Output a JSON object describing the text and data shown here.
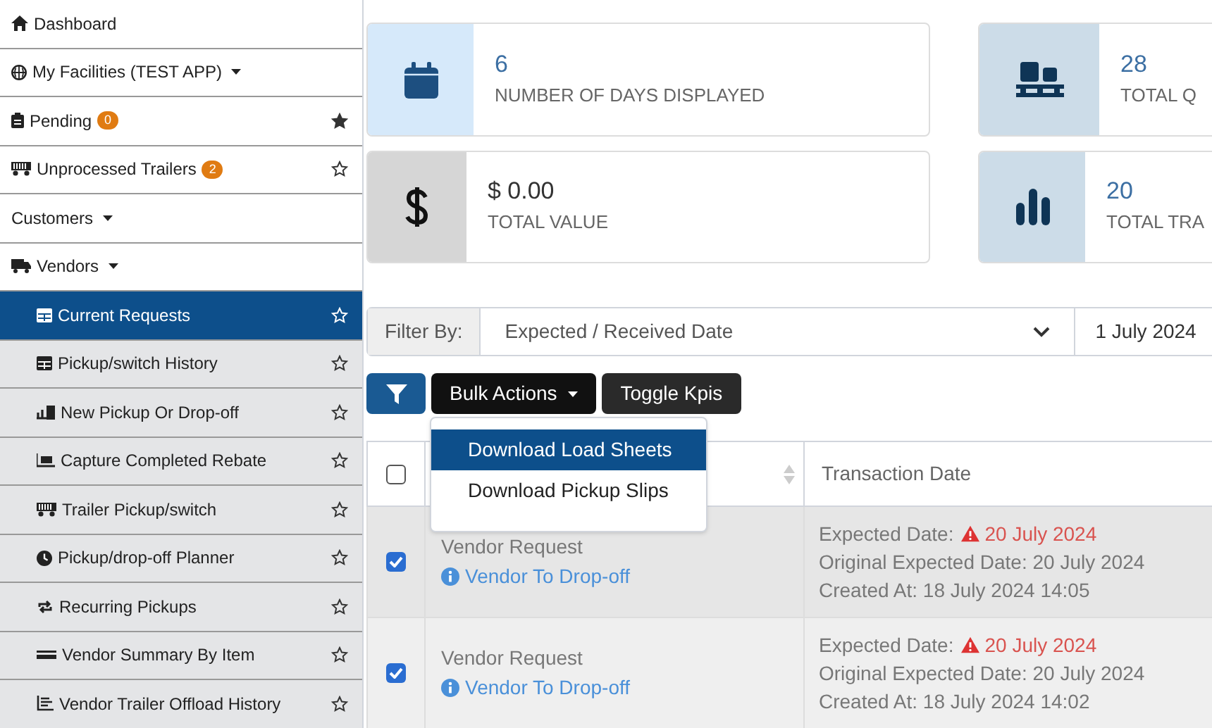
{
  "sidebar": {
    "items": [
      {
        "label": "Dashboard",
        "dropdown": false,
        "selected": false
      },
      {
        "label": "My Facilities (TEST APP)",
        "dropdown": true,
        "selected": false
      },
      {
        "label": "Pending",
        "badge": "0",
        "dropdown": false,
        "starred": true,
        "selected": false
      },
      {
        "label": "Unprocessed Trailers",
        "badge": "2",
        "dropdown": false,
        "starred": false,
        "selected": false
      },
      {
        "label": "Customers",
        "dropdown": true,
        "selected": false
      },
      {
        "label": "Vendors",
        "dropdown": true,
        "selected": false,
        "children": [
          {
            "label": "Current Requests",
            "starred": false,
            "selected": true
          },
          {
            "label": "Pickup/switch History",
            "starred": false,
            "selected": false
          },
          {
            "label": "New Pickup Or Drop-off",
            "starred": false,
            "selected": false
          },
          {
            "label": "Capture Completed Rebate",
            "starred": false,
            "selected": false
          },
          {
            "label": "Trailer Pickup/switch",
            "starred": false,
            "selected": false
          },
          {
            "label": "Pickup/drop-off Planner",
            "starred": false,
            "selected": false
          },
          {
            "label": "Recurring Pickups",
            "starred": false,
            "selected": false
          },
          {
            "label": "Vendor Summary By Item",
            "starred": false,
            "selected": false
          },
          {
            "label": "Vendor Trailer Offload History",
            "starred": false,
            "selected": false
          }
        ]
      }
    ]
  },
  "kpis": [
    {
      "value": "6",
      "label": "NUMBER OF DAYS DISPLAYED",
      "color": "#d6e9fa"
    },
    {
      "value": "28",
      "label": "TOTAL Q",
      "color": "#ccdce8"
    },
    {
      "value": "$ 0.00",
      "label": "TOTAL VALUE",
      "color": "#d6d6d6"
    },
    {
      "value": "20",
      "label": "TOTAL TRA",
      "color": "#ccdce8"
    }
  ],
  "filter": {
    "label": "Filter By:",
    "value": "Expected / Received Date",
    "date": "1 July 2024"
  },
  "toolbar": {
    "bulk_actions": "Bulk Actions",
    "toggle": "Toggle Kpis"
  },
  "bulk_menu": [
    {
      "label": "Download Load Sheets",
      "selected": true
    },
    {
      "label": "Download Pickup Slips",
      "selected": false
    }
  ],
  "table": {
    "header_checked": false,
    "columns": [
      "Transaction Date"
    ],
    "rows": [
      {
        "checked": true,
        "type": "Vendor Request",
        "link": "Vendor To Drop-off",
        "expected_label": "Expected Date:",
        "expected": "20 July 2024",
        "original": "Original Expected Date: 20 July 2024",
        "created": "Created At: 18 July 2024 14:05"
      },
      {
        "checked": true,
        "type": "Vendor Request",
        "link": "Vendor To Drop-off",
        "expected_label": "Expected Date:",
        "expected": "20 July 2024",
        "original": "Original Expected Date: 20 July 2024",
        "created": "Created At: 18 July 2024 14:02"
      }
    ]
  }
}
